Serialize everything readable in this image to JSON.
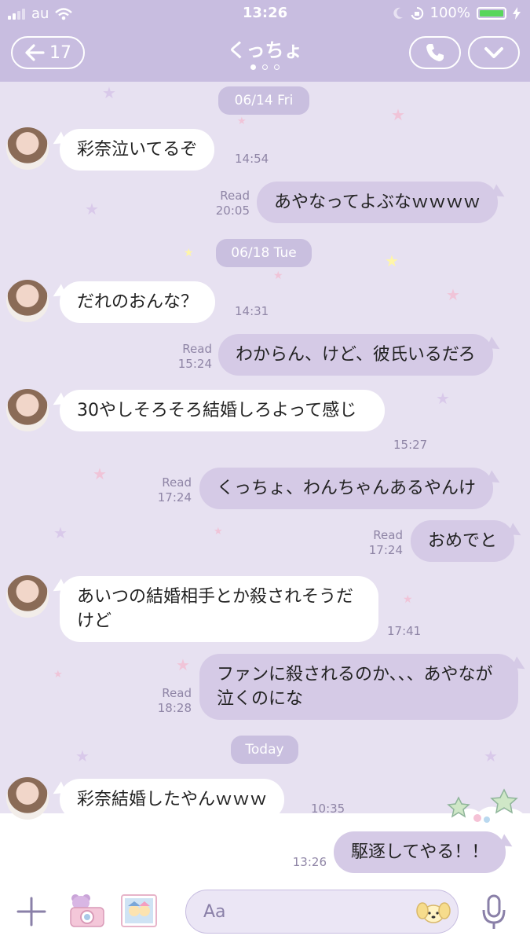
{
  "status_bar": {
    "carrier": "au",
    "time": "13:26",
    "battery": "100%"
  },
  "header": {
    "back_count": "17",
    "title": "くっちょ"
  },
  "conversation": [
    {
      "type": "date",
      "label": "06/14 Fri"
    },
    {
      "type": "in",
      "text": "彩奈泣いてるぞ",
      "time": "14:54"
    },
    {
      "type": "out",
      "text": "あやなってよぶなｗｗｗｗ",
      "read": "Read",
      "time": "20:05"
    },
    {
      "type": "date",
      "label": "06/18 Tue"
    },
    {
      "type": "in",
      "text": "だれのおんな？",
      "time": "14:31"
    },
    {
      "type": "out",
      "text": "わからん、けど、彼氏いるだろ",
      "read": "Read",
      "time": "15:24"
    },
    {
      "type": "in",
      "text": "30やしそろそろ結婚しろよって感じ",
      "time": "15:27"
    },
    {
      "type": "out",
      "text": "くっちょ、わんちゃんあるやんけ",
      "read": "Read",
      "time": "17:24"
    },
    {
      "type": "out",
      "text": "おめでと",
      "read": "Read",
      "time": "17:24"
    },
    {
      "type": "in",
      "text": "あいつの結婚相手とか殺されそうだけど",
      "time": "17:41"
    },
    {
      "type": "out",
      "text": "ファンに殺されるのか、、、あやなが泣くのにな",
      "read": "Read",
      "time": "18:28"
    },
    {
      "type": "date",
      "label": "Today"
    },
    {
      "type": "in",
      "text": "彩奈結婚したやんｗｗｗ",
      "time": "10:35"
    },
    {
      "type": "out",
      "text": "駆逐してやる！！",
      "time": "13:26"
    }
  ],
  "input": {
    "placeholder": "Aa"
  },
  "icons": [
    "signal-icon",
    "wifi-icon",
    "moon-icon",
    "lock-rotation-icon",
    "battery-icon",
    "charging-icon",
    "back-arrow-icon",
    "phone-icon",
    "chevron-down-icon",
    "plus-icon",
    "camera-icon",
    "sticker-icon",
    "dog-icon",
    "mic-icon"
  ],
  "colors": {
    "header": "#c8bde0",
    "chat_bg": "#e7e1f1",
    "out_bubble": "#d5cae6",
    "in_bubble": "#ffffff",
    "accent": "#8a80a8"
  }
}
